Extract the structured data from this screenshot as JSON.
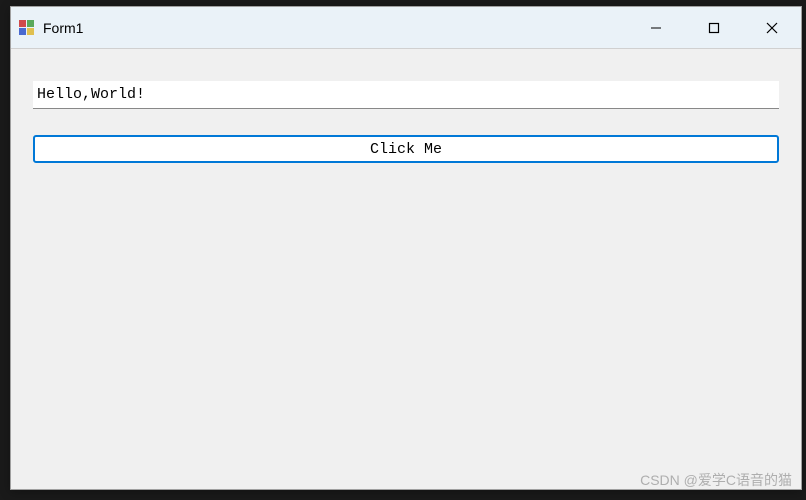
{
  "window": {
    "title": "Form1"
  },
  "form": {
    "textbox_value": "Hello,World!",
    "button_label": "Click Me"
  },
  "watermark": "CSDN @爱学C语音的猫"
}
